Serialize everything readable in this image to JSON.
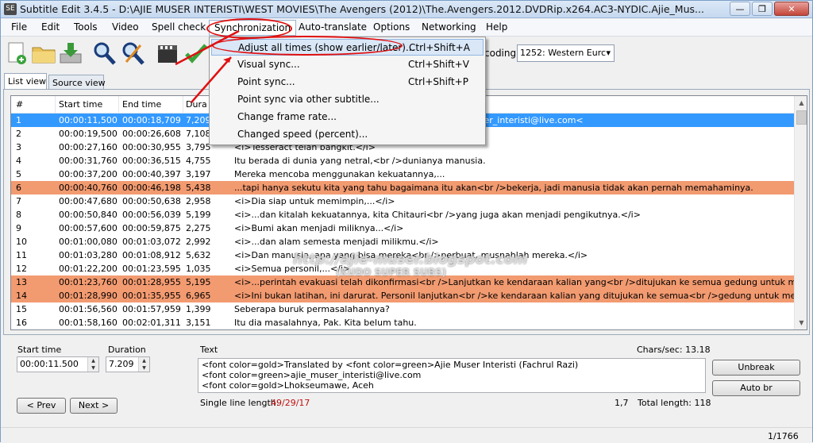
{
  "window": {
    "title": "Subtitle Edit 3.4.5 - D:\\AJIE MUSER INTERISTI\\WEST MOVIES\\The Avengers (2012)\\The.Avengers.2012.DVDRip.x264.AC3-NYDIC.Ajie_Mus...",
    "app_icon": "SE",
    "minimize": "—",
    "maximize": "❐",
    "close": "✕"
  },
  "menu": [
    "File",
    "Edit",
    "Tools",
    "Video",
    "Spell check",
    "Synchronization",
    "Auto-translate",
    "Options",
    "Networking",
    "Help"
  ],
  "toolbar": {
    "icons": [
      "new-file-icon",
      "open-folder-icon",
      "download-icon",
      "find-icon",
      "replace-icon",
      "video-icon",
      "check-icon"
    ],
    "encoding_label": "coding",
    "encoding_value": "1252: Western Eurc",
    "encoding_arrow": "▾"
  },
  "tabs": [
    "List view",
    "Source view"
  ],
  "list": {
    "headers": [
      "#",
      "Start time",
      "End time",
      "Dura"
    ],
    "rows": [
      {
        "n": "1",
        "start": "00:00:11,500",
        "end": "00:00:18,709",
        "dur": "7,209",
        "text": "nteristi (Fachrul Razi)<br /><font color=green>ajie_muser_interisti@live.com<"
      },
      {
        "n": "2",
        "start": "00:00:19,500",
        "end": "00:00:26,608",
        "dur": "7,108",
        "text": ""
      },
      {
        "n": "3",
        "start": "00:00:27,160",
        "end": "00:00:30,955",
        "dur": "3,795",
        "text": "<i>Tesseract telah bangkit.</i>"
      },
      {
        "n": "4",
        "start": "00:00:31,760",
        "end": "00:00:36,515",
        "dur": "4,755",
        "text": "Itu berada di dunia yang netral,<br />dunianya manusia."
      },
      {
        "n": "5",
        "start": "00:00:37,200",
        "end": "00:00:40,397",
        "dur": "3,197",
        "text": "Mereka mencoba menggunakan kekuatannya,..."
      },
      {
        "n": "6",
        "start": "00:00:40,760",
        "end": "00:00:46,198",
        "dur": "5,438",
        "text": "...tapi hanya sekutu kita yang tahu bagaimana itu akan<br />bekerja, jadi manusia tidak akan pernah memahaminya."
      },
      {
        "n": "7",
        "start": "00:00:47,680",
        "end": "00:00:50,638",
        "dur": "2,958",
        "text": "<i>Dia siap untuk memimpin,...</i>"
      },
      {
        "n": "8",
        "start": "00:00:50,840",
        "end": "00:00:56,039",
        "dur": "5,199",
        "text": "<i>...dan kitalah kekuatannya, kita Chitauri<br />yang juga akan menjadi pengikutnya.</i>"
      },
      {
        "n": "9",
        "start": "00:00:57,600",
        "end": "00:00:59,875",
        "dur": "2,275",
        "text": "<i>Bumi akan menjadi miliknya...</i>"
      },
      {
        "n": "10",
        "start": "00:01:00,080",
        "end": "00:01:03,072",
        "dur": "2,992",
        "text": "<i>...dan alam semesta menjadi milikmu.</i>"
      },
      {
        "n": "11",
        "start": "00:01:03,280",
        "end": "00:01:08,912",
        "dur": "5,632",
        "text": "<i>Dan manusia, apa yang bisa mereka<br />perbuat, musnahlah mereka.</i>"
      },
      {
        "n": "12",
        "start": "00:01:22,200",
        "end": "00:01:23,595",
        "dur": "1,035",
        "text": "<i>Semua personil,...</i>"
      },
      {
        "n": "13",
        "start": "00:01:23,760",
        "end": "00:01:28,955",
        "dur": "5,195",
        "text": "<i>...perintah evakuasi telah dikonfirmasi<br />Lanjutkan ke kendaraan kalian yang<br />ditujukan ke semua gedung untuk mengevakuasi...</i>"
      },
      {
        "n": "14",
        "start": "00:01:28,990",
        "end": "00:01:35,955",
        "dur": "6,965",
        "text": "<i>Ini bukan latihan, ini darurat. Personil lanjutkan<br />ke kendaraan kalian yang ditujukan ke semua<br />gedung untuk mengevakuasi.</i>"
      },
      {
        "n": "15",
        "start": "00:01:56,560",
        "end": "00:01:57,959",
        "dur": "1,399",
        "text": "Seberapa buruk permasalahannya?"
      },
      {
        "n": "16",
        "start": "00:01:58,160",
        "end": "00:02:01,311",
        "dur": "3,151",
        "text": "Itu dia masalahnya, Pak. Kita belum tahu."
      }
    ]
  },
  "editor": {
    "start_label": "Start time",
    "start_value": "00:00:11.500",
    "duration_label": "Duration",
    "duration_value": "7.209",
    "text_label": "Text",
    "text_value": "<font color=gold>Translated by <font color=green>Ajie Muser Interisti (Fachrul Razi)\n<font color=green>ajie_muser_interisti@live.com\n<font color=gold>Lhokseumawe, Aceh",
    "chars_sec": "Chars/sec: 13.18",
    "single_line_label": "Single line length:",
    "single_line_value": "49/29/17",
    "cursor_pos": "1,7",
    "total_length": "Total length: 118",
    "prev": "< Prev",
    "next": "Next >",
    "unbreak": "Unbreak",
    "auto_br": "Auto br"
  },
  "status": {
    "position": "1/1766"
  },
  "dropdown": [
    {
      "label": "Adjust all times (show earlier/later)...",
      "shortcut": "Ctrl+Shift+A"
    },
    {
      "label": "Visual sync...",
      "shortcut": "Ctrl+Shift+V"
    },
    {
      "label": "Point sync...",
      "shortcut": "Ctrl+Shift+P"
    },
    {
      "label": "Point sync via other subtitle...",
      "shortcut": ""
    },
    {
      "label": "Change frame rate...",
      "shortcut": ""
    },
    {
      "label": "Changed speed (percent)...",
      "shortcut": ""
    }
  ],
  "watermark": {
    "line1": "http://ajie-muser.blogspot.com",
    "line2": "(KUDO SUPER SUBS)"
  },
  "colors": {
    "selected": "#3399ff",
    "highlight": "#f29a70",
    "red_annotation": "#e01010"
  }
}
